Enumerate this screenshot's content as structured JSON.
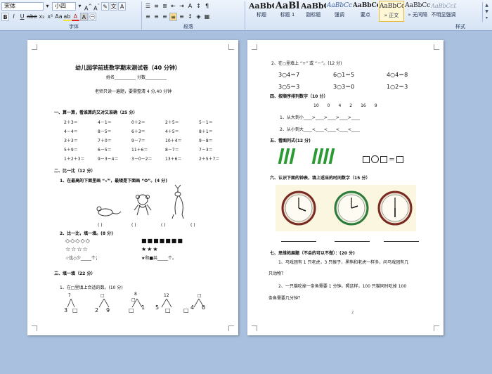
{
  "ribbon": {
    "font_name": "宋体",
    "font_size": "小四",
    "groups": {
      "font": "字体",
      "paragraph": "段落",
      "styles": "样式"
    },
    "styles": [
      {
        "sample": "AaBbC",
        "name": "标题"
      },
      {
        "sample": "AaBl",
        "name": "标题 1"
      },
      {
        "sample": "AaBbC",
        "name": "副标题"
      },
      {
        "sample": "AaBbCcDt",
        "name": "强调"
      },
      {
        "sample": "AaBbCcD",
        "name": "要点"
      },
      {
        "sample": "AaBbCcDt",
        "name": "» 正文"
      },
      {
        "sample": "AaBbCcDt",
        "name": "» 无间隔"
      },
      {
        "sample": "AaBbCcDt",
        "name": "不明显强调"
      }
    ]
  },
  "left_page": {
    "title": "幼儿园学前班数学期末测试卷（40 分钟）",
    "name_label": "姓名",
    "score_label": "分数",
    "instruction": "老师只读一遍题，要需整清 4 分,40 分钟",
    "section1": "一、算一算，看谁算的又对又准确（25 分）",
    "calc_rows": [
      [
        "2＋3＝",
        "4－1＝",
        "0＋2＝",
        "2＋5＝",
        "5－1＝"
      ],
      [
        "4－4＝",
        "8－5＝",
        "6＋3＝",
        "4＋5＝",
        "8＋1＝"
      ],
      [
        "3＋3＝",
        "7＋0＝",
        "9－7＝",
        "10＋4＝",
        "9－8＝"
      ],
      [
        "5＋9＝",
        "6－5＝",
        "11＋6＝",
        "8－7＝",
        "7－3＝"
      ],
      [
        "1＋2＋3＝",
        "9－3－4＝",
        "3－0－2＝",
        "13＋6＝",
        "2＋5＋7＝"
      ]
    ],
    "section2": "二、比一比（12 分）",
    "q2_1": "1、在最高的下面里画 “√”，最矮是下面画 “O”。(4 分)",
    "parens": [
      "(      )",
      "(      )",
      "(      )",
      "(      )"
    ],
    "q2_2": "2、比一比，填一填。(8 分)",
    "circles": "◇◇◇◇◇",
    "squares": "■■■■■■■",
    "stars_a": "☆☆☆☆",
    "stars_b": "★★★",
    "compare_a": "☆比◇少_____个；",
    "compare_b": "★和■共_____个。",
    "section3": "三、填一填（22 分）",
    "q3_1": "1、在□里填上合适的数。(10 分)",
    "tree_tops": [
      "7",
      "□",
      "8",
      "□",
      "12",
      "□"
    ],
    "tree_bottoms": [
      [
        "3",
        "□"
      ],
      [
        "2",
        "9"
      ],
      [
        "□",
        "1"
      ],
      [
        "5",
        "□"
      ],
      [
        "□",
        "4"
      ],
      [
        "0",
        ""
      ]
    ]
  },
  "right_page": {
    "q2": "2、在○里填上 “+” 或 “－”。(12 分)",
    "ops": [
      [
        "3○4＝7",
        "6○1＝5",
        "4○4＝8"
      ],
      [
        "3○5＝3",
        "3○3＝0",
        "1○2＝3"
      ]
    ],
    "section4": "四、按顺序排列数字（10 分）",
    "numbers": "10　　0　　4　　2　　16　　9",
    "big_to_small": "1、从大到小____>____>____>____>____",
    "small_to_big": "2、从小到大____<____<____<____<____",
    "section5": "五、看图列式(12 分)",
    "sticks_a": 3,
    "sticks_b": 4,
    "section6": "六、认识下面的钟表，填上适当的时间数字（15 分）",
    "clock_colors": [
      "#7a2a22",
      "#2e7a3a",
      "#7a2a22"
    ],
    "section7": "七、思维拓展题（不会的可以不做）：(20 分)",
    "p7_1": "1、马戏团有 1 只老虎，3 只猴子，黑熊和老虎一样多，问马戏团有几",
    "p7_1b": "只动物？",
    "p7_2": "2、一只猫吃掉一条鱼需要 1 分钟。照这样，100 只猫同时吃掉 100",
    "p7_2b": "条鱼需要几分钟？",
    "page_num": "2"
  }
}
